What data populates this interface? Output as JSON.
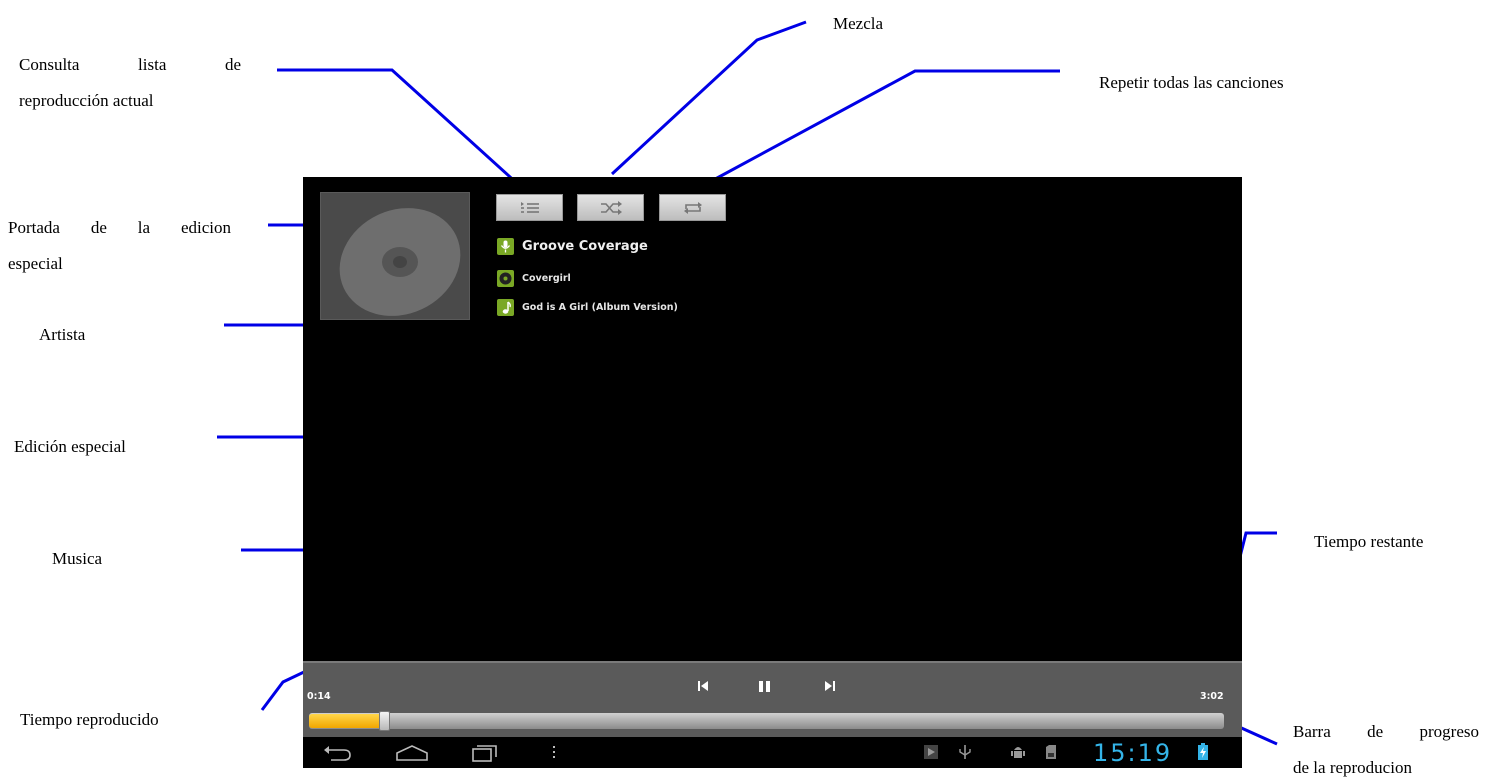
{
  "annotations": {
    "consulta_line1": "Consulta",
    "consulta_line2": "lista",
    "consulta_line3": "de",
    "consulta_line4": "reproducción actual",
    "mezcla": "Mezcla",
    "repetir": "Repetir todas las canciones",
    "portada_line1a": "Portada",
    "portada_line1b": "de",
    "portada_line1c": "la",
    "portada_line1d": "edicion",
    "portada_line2": "especial",
    "artista": "Artista",
    "edicion": "Edición especial",
    "musica": "Musica",
    "tiempo_restante": "Tiempo restante",
    "tiempo_reproducido": "Tiempo reproducido",
    "barra_line1a": "Barra",
    "barra_line1b": "de",
    "barra_line1c": "progreso",
    "barra_line2": "de la reproducion"
  },
  "player": {
    "artist": "Groove Coverage",
    "album": "Covergirl",
    "song": "God is A Girl (Album Version)",
    "elapsed": "0:14",
    "remaining": "3:02",
    "progress_fraction": 0.082
  },
  "icons": {
    "playlist": "playlist-icon",
    "shuffle": "shuffle-icon",
    "repeat": "repeat-icon",
    "artist": "microphone-icon",
    "album": "disc-icon",
    "song": "music-note-icon",
    "prev": "previous-icon",
    "pause": "pause-icon",
    "next": "next-icon",
    "back": "back-icon",
    "home": "home-icon",
    "recents": "recent-apps-icon",
    "menu": "menu-icon"
  },
  "status_bar": {
    "clock": "15:19"
  },
  "colors": {
    "annotation_line": "#0000e6",
    "progress_fill": "#f2a600",
    "clock": "#34b4e8",
    "icon_badge": "#7aa825"
  }
}
